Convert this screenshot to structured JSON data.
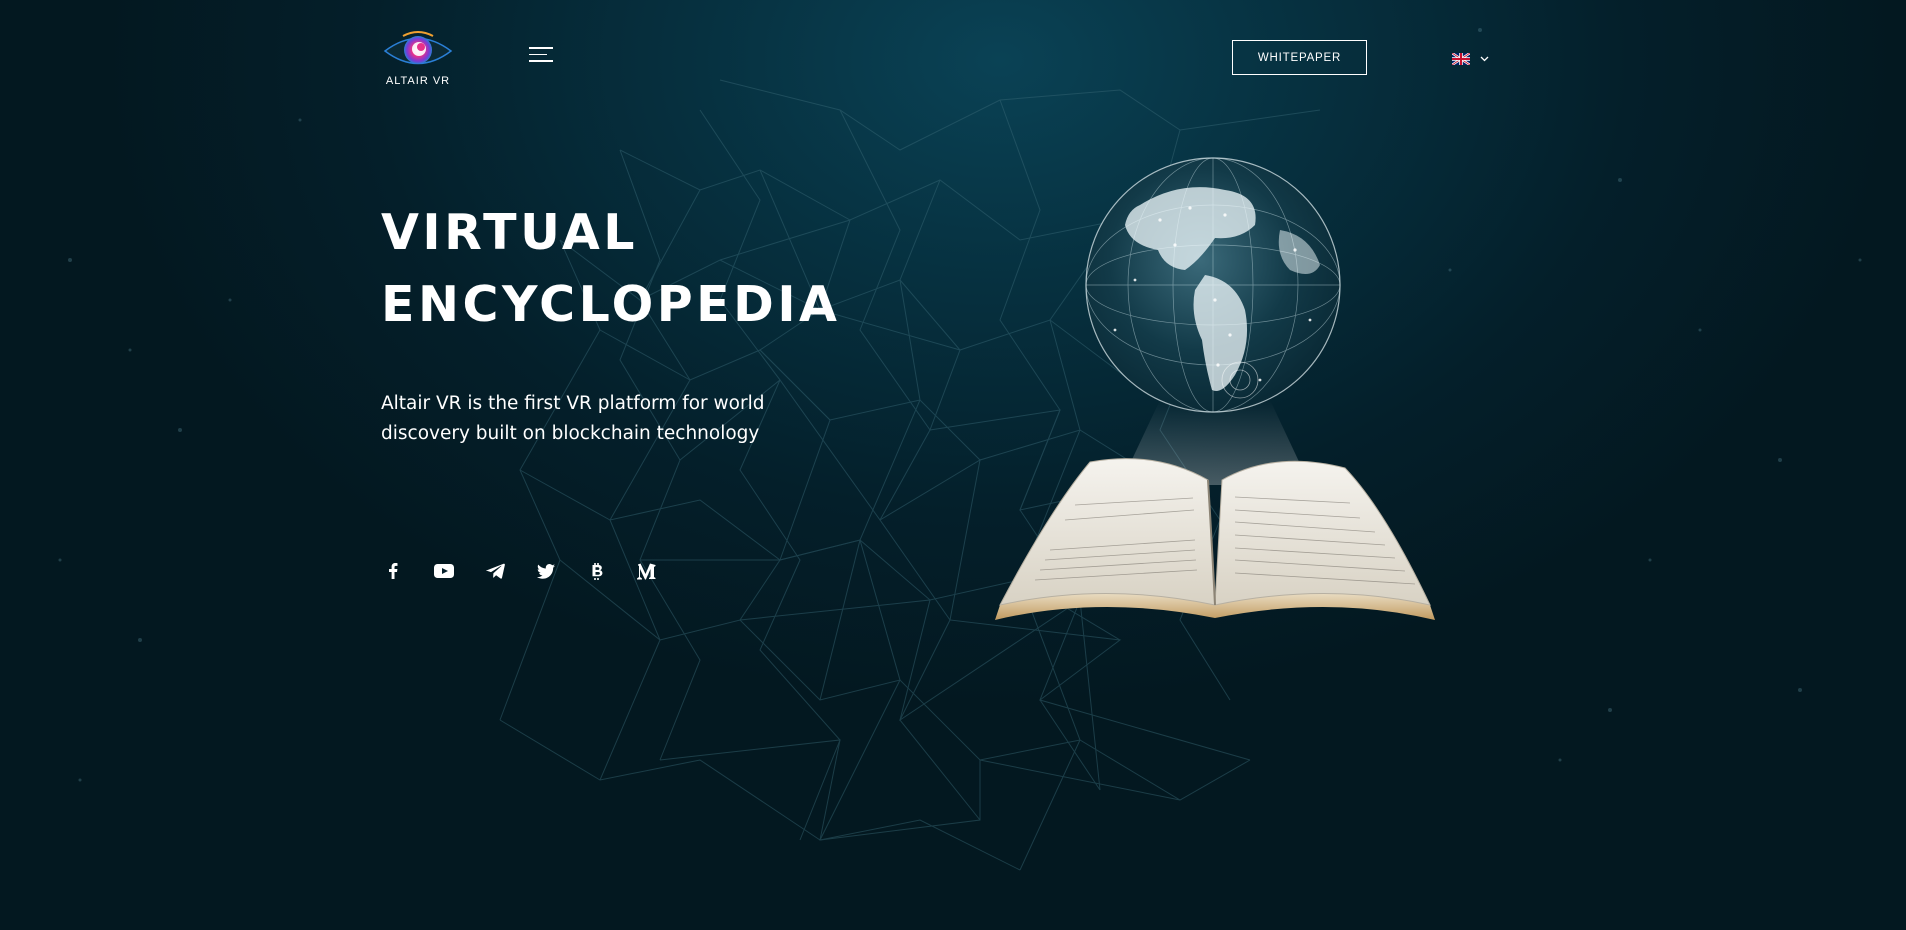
{
  "header": {
    "logo_text": "ALTAIR VR",
    "whitepaper_label": "WHITEPAPER",
    "language_flag": "uk-flag-icon"
  },
  "hero": {
    "title_line1": "VIRTUAL",
    "title_line2": "ENCYCLOPEDIA",
    "description_line1": "Altair VR is the first VR platform for world",
    "description_line2": "discovery built on blockchain technology"
  },
  "socials": [
    {
      "icon": "facebook-icon"
    },
    {
      "icon": "youtube-icon"
    },
    {
      "icon": "telegram-icon"
    },
    {
      "icon": "twitter-icon"
    },
    {
      "icon": "bitcoin-icon"
    },
    {
      "icon": "medium-icon"
    }
  ],
  "colors": {
    "background": "#041f2a",
    "background_glow": "#0a4255",
    "text": "#ffffff",
    "network_lines": "#3a6a78",
    "logo_accent_pink": "#e8318a",
    "logo_accent_blue": "#2a7fd6"
  }
}
